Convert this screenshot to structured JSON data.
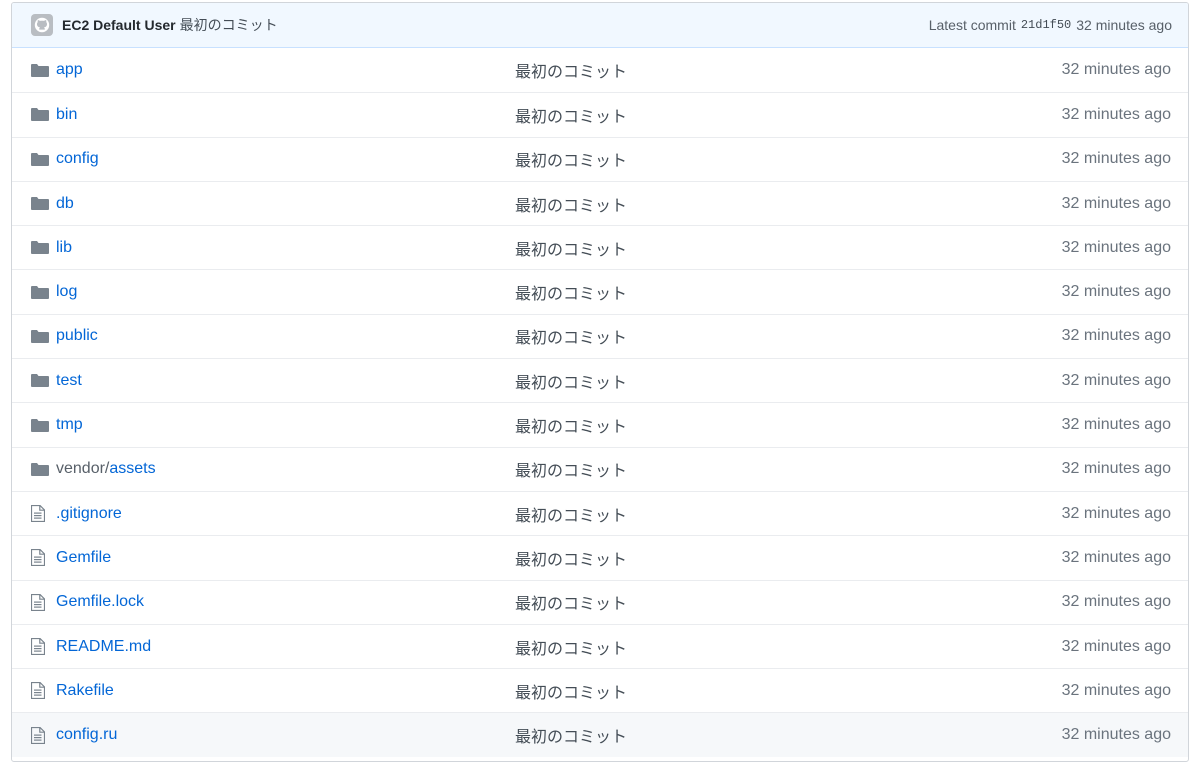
{
  "commit": {
    "author": "EC2 Default User",
    "message": "最初のコミット",
    "latest_label": "Latest commit",
    "sha": "21d1f50",
    "age": "32 minutes ago"
  },
  "files": [
    {
      "name": "app",
      "type": "dir",
      "message": "最初のコミット",
      "age": "32 minutes ago"
    },
    {
      "name": "bin",
      "type": "dir",
      "message": "最初のコミット",
      "age": "32 minutes ago"
    },
    {
      "name": "config",
      "type": "dir",
      "message": "最初のコミット",
      "age": "32 minutes ago"
    },
    {
      "name": "db",
      "type": "dir",
      "message": "最初のコミット",
      "age": "32 minutes ago"
    },
    {
      "name": "lib",
      "type": "dir",
      "message": "最初のコミット",
      "age": "32 minutes ago"
    },
    {
      "name": "log",
      "type": "dir",
      "message": "最初のコミット",
      "age": "32 minutes ago"
    },
    {
      "name": "public",
      "type": "dir",
      "message": "最初のコミット",
      "age": "32 minutes ago"
    },
    {
      "name": "test",
      "type": "dir",
      "message": "最初のコミット",
      "age": "32 minutes ago"
    },
    {
      "name": "tmp",
      "type": "dir",
      "message": "最初のコミット",
      "age": "32 minutes ago"
    },
    {
      "name": "assets",
      "prefix": "vendor/",
      "type": "dir",
      "message": "最初のコミット",
      "age": "32 minutes ago"
    },
    {
      "name": ".gitignore",
      "type": "file",
      "message": "最初のコミット",
      "age": "32 minutes ago"
    },
    {
      "name": "Gemfile",
      "type": "file",
      "message": "最初のコミット",
      "age": "32 minutes ago"
    },
    {
      "name": "Gemfile.lock",
      "type": "file",
      "message": "最初のコミット",
      "age": "32 minutes ago"
    },
    {
      "name": "README.md",
      "type": "file",
      "message": "最初のコミット",
      "age": "32 minutes ago"
    },
    {
      "name": "Rakefile",
      "type": "file",
      "message": "最初のコミット",
      "age": "32 minutes ago"
    },
    {
      "name": "config.ru",
      "type": "file",
      "message": "最初のコミット",
      "age": "32 minutes ago",
      "hovered": true
    }
  ],
  "icons": {
    "dir": "folder-icon",
    "file": "file-text-icon"
  },
  "colors": {
    "link": "#0366d6",
    "icon": "#79838d",
    "commit_bg": "#f1f8ff"
  }
}
